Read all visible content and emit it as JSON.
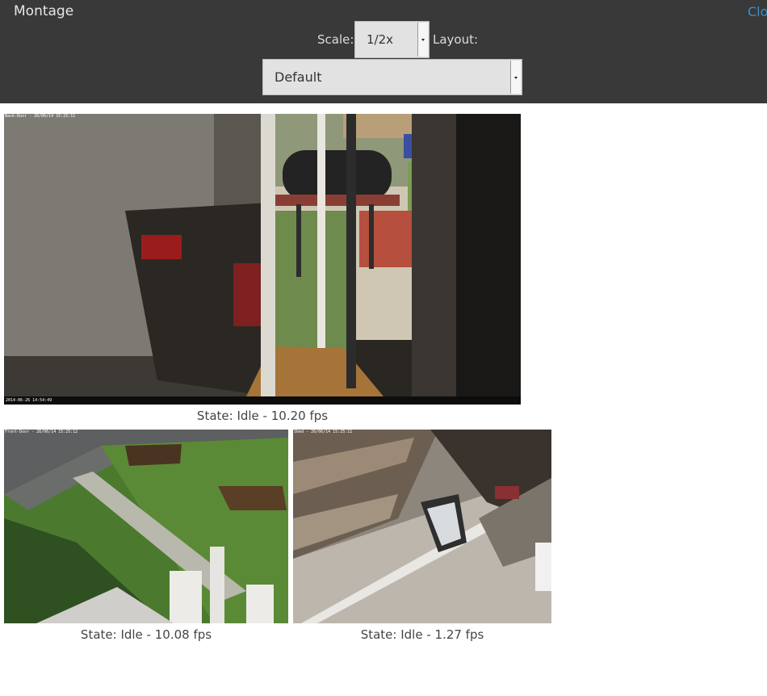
{
  "header": {
    "title": "Montage",
    "close_label": "Clo",
    "scale_label": "Scale:",
    "scale_value": "1/2x",
    "layout_label": "Layout:",
    "layout_value": "Default"
  },
  "monitors": [
    {
      "name": "Back-Door",
      "osd_top": "Back-Door - 26/06/14 15:25:11",
      "osd_bottom": "2014-06-26 14:54:49",
      "status": "State: Idle - 10.20 fps"
    },
    {
      "name": "Front-Door",
      "osd_top": "Front-Door - 26/06/14 15:25:12",
      "status": "State: Idle - 10.08 fps"
    },
    {
      "name": "Shed",
      "osd_top": "Shed - 26/06/14 15:25:11",
      "status": "State: Idle - 1.27 fps"
    }
  ],
  "colors": {
    "header_bg": "#393939",
    "link": "#3b8ec6",
    "select_bg": "#e2e2e2"
  }
}
